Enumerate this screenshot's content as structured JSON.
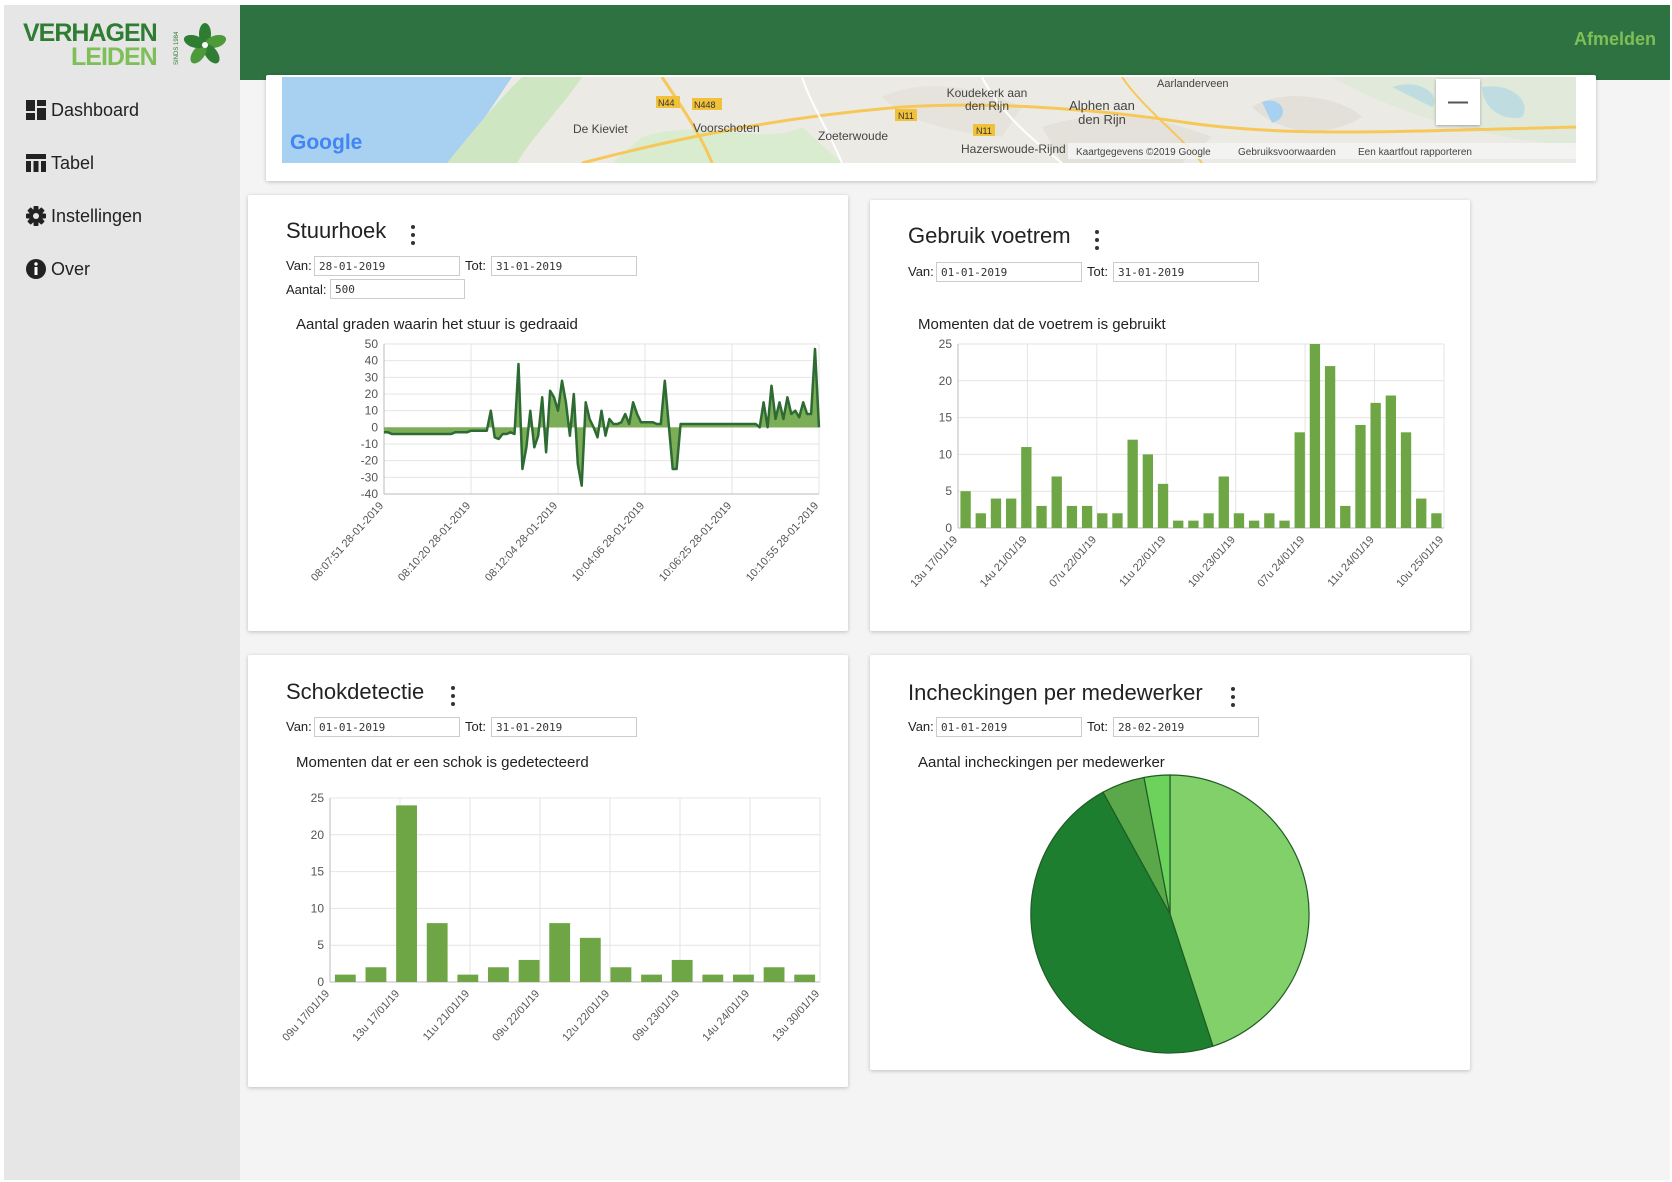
{
  "app": {
    "logo_line1": "VERHAGEN",
    "logo_line2": "LEIDEN",
    "logo_tag": "SINDS 1984",
    "logout_label": "Afmelden",
    "brand_color": "#2d7240",
    "accent_color": "#7fbf58"
  },
  "sidebar": {
    "items": [
      {
        "label": "Dashboard",
        "icon": "dashboard-icon"
      },
      {
        "label": "Tabel",
        "icon": "table-icon"
      },
      {
        "label": "Instellingen",
        "icon": "gear-icon"
      },
      {
        "label": "Over",
        "icon": "info-icon"
      }
    ]
  },
  "map": {
    "labels": [
      "N44",
      "N448",
      "De Kieviet",
      "Voorschoten",
      "Zoeterwoude",
      "N11",
      "N11",
      "Koudekerk aan den Rijn",
      "Alphen aan den Rijn",
      "Aarlanderveen",
      "Hazerswoude-Rijnd"
    ],
    "google": "Google",
    "attribution": [
      "Kaartgegevens ©2019 Google",
      "Gebruiksvoorwaarden",
      "Een kaartfout rapporteren"
    ],
    "zoom_out_symbol": "—"
  },
  "cards": {
    "stuurhoek": {
      "title": "Stuurhoek",
      "van_label": "Van:",
      "van_value": "28-01-2019",
      "tot_label": "Tot:",
      "tot_value": "31-01-2019",
      "aantal_label": "Aantal:",
      "aantal_value": "500",
      "subtitle": "Aantal graden waarin het stuur is gedraaid"
    },
    "voetrem": {
      "title": "Gebruik voetrem",
      "van_label": "Van:",
      "van_value": "01-01-2019",
      "tot_label": "Tot:",
      "tot_value": "31-01-2019",
      "subtitle": "Momenten dat de voetrem is gebruikt"
    },
    "schok": {
      "title": "Schokdetectie",
      "van_label": "Van:",
      "van_value": "01-01-2019",
      "tot_label": "Tot:",
      "tot_value": "31-01-2019",
      "subtitle": "Momenten dat er een schok is gedetecteerd"
    },
    "incheck": {
      "title": "Incheckingen per medewerker",
      "van_label": "Van:",
      "van_value": "01-01-2019",
      "tot_label": "Tot:",
      "tot_value": "28-02-2019",
      "subtitle": "Aantal incheckingen per medewerker"
    }
  },
  "chart_data": [
    {
      "id": "stuurhoek",
      "type": "area",
      "color": "#2e6b34",
      "fill": "#6ea545",
      "ylim": [
        -40,
        50
      ],
      "yticks": [
        50,
        40,
        30,
        20,
        10,
        0,
        -10,
        -20,
        -30,
        -40
      ],
      "xtick_labels": [
        "08:07:51 28-01-2019",
        "08:10:20 28-01-2019",
        "08:12:04 28-01-2019",
        "10:04:06 28-01-2019",
        "10:06:25 28-01-2019",
        "10:10:55 28-01-2019"
      ],
      "values": [
        -3,
        -3,
        -4,
        -4,
        -4,
        -4,
        -4,
        -4,
        -4,
        -4,
        -4,
        -4,
        -4,
        -4,
        -4,
        -4,
        -4,
        -4,
        -3,
        -3,
        -3,
        -3,
        -2,
        -2,
        -2,
        -2,
        -2,
        10,
        -6,
        -7,
        -4,
        -4,
        -3,
        -4,
        38,
        -25,
        -12,
        10,
        -12,
        -5,
        18,
        -15,
        22,
        18,
        10,
        28,
        15,
        -5,
        20,
        -22,
        -35,
        15,
        5,
        0,
        -6,
        10,
        -5,
        5,
        2,
        2,
        3,
        8,
        2,
        15,
        8,
        3,
        3,
        3,
        3,
        2,
        2,
        28,
        2,
        -25,
        -25,
        2,
        2,
        2,
        2,
        2,
        2,
        2,
        2,
        2,
        2,
        2,
        2,
        2,
        2,
        2,
        2,
        2,
        2,
        2,
        2,
        0,
        15,
        0,
        25,
        5,
        15,
        5,
        18,
        8,
        10,
        6,
        15,
        8,
        8,
        47,
        0
      ]
    },
    {
      "id": "voetrem",
      "type": "bar",
      "color": "#6ea545",
      "ylim": [
        0,
        25
      ],
      "yticks": [
        25,
        20,
        15,
        10,
        5,
        0
      ],
      "values": [
        5,
        2,
        4,
        4,
        11,
        3,
        7,
        3,
        3,
        2,
        2,
        12,
        10,
        6,
        1,
        1,
        2,
        7,
        2,
        1,
        2,
        1,
        13,
        25,
        22,
        3,
        14,
        17,
        18,
        13,
        4,
        2
      ],
      "xtick_labels": [
        "13u 17/01/19",
        "14u 21/01/19",
        "07u 22/01/19",
        "11u 22/01/19",
        "10u 23/01/19",
        "07u 24/01/19",
        "11u 24/01/19",
        "10u 25/01/19"
      ]
    },
    {
      "id": "schok",
      "type": "bar",
      "color": "#6ea545",
      "ylim": [
        0,
        25
      ],
      "yticks": [
        25,
        20,
        15,
        10,
        5,
        0
      ],
      "values": [
        1,
        2,
        24,
        8,
        1,
        2,
        3,
        8,
        6,
        2,
        1,
        3,
        1,
        1,
        2,
        1
      ],
      "xtick_labels": [
        "09u 17/01/19",
        "13u 17/01/19",
        "11u 21/01/19",
        "09u 22/01/19",
        "12u 22/01/19",
        "09u 23/01/19",
        "14u 24/01/19",
        "13u 30/01/19"
      ]
    },
    {
      "id": "incheck",
      "type": "pie",
      "slices": [
        {
          "value": 45,
          "color": "#82d06a"
        },
        {
          "value": 47,
          "color": "#1e7e2f"
        },
        {
          "value": 5,
          "color": "#5ba84a"
        },
        {
          "value": 3,
          "color": "#6cd25c"
        }
      ]
    }
  ]
}
